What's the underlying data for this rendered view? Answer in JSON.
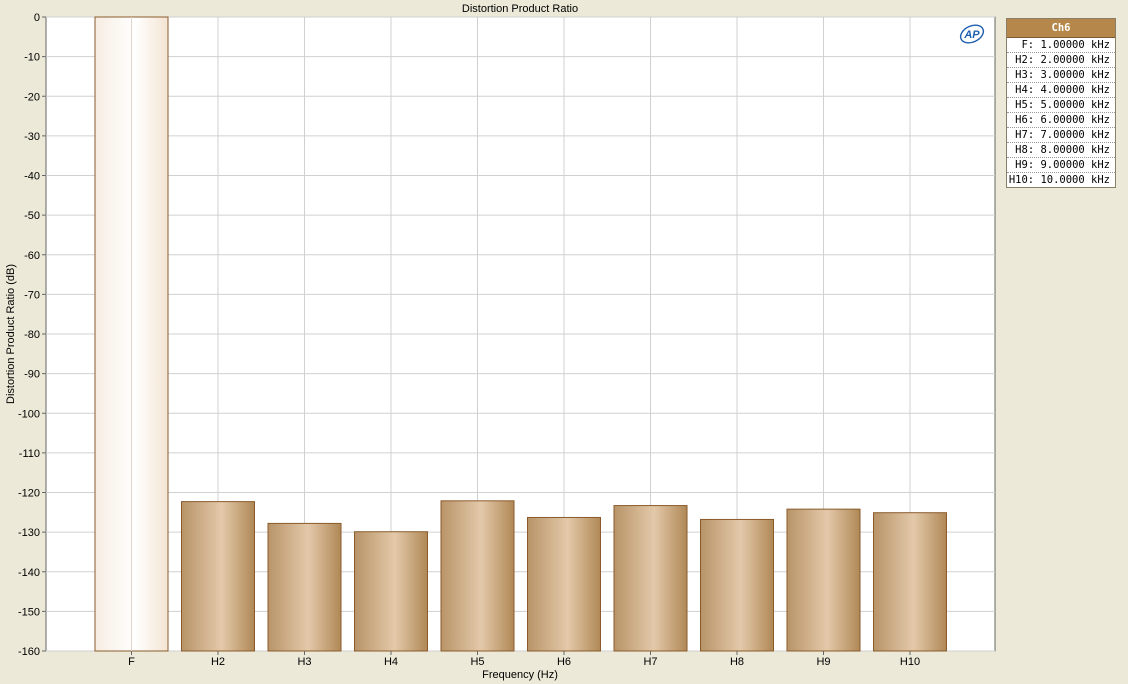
{
  "chart_data": {
    "type": "bar",
    "title": "Distortion Product Ratio",
    "xlabel": "Frequency (Hz)",
    "ylabel": "Distortion Product Ratio (dB)",
    "ylim": [
      -160,
      0
    ],
    "yticks": [
      0,
      -10,
      -20,
      -30,
      -40,
      -50,
      -60,
      -70,
      -80,
      -90,
      -100,
      -110,
      -120,
      -130,
      -140,
      -150,
      -160
    ],
    "grid": true,
    "categories": [
      "F",
      "H2",
      "H3",
      "H4",
      "H5",
      "H6",
      "H7",
      "H8",
      "H9",
      "H10"
    ],
    "series": [
      {
        "name": "Ch6",
        "values": [
          0,
          -122.3,
          -127.8,
          -129.9,
          -122.1,
          -126.3,
          -123.3,
          -126.8,
          -124.2,
          -125.1
        ],
        "color": "#c9a47a"
      }
    ]
  },
  "logo": {
    "text": "AP",
    "color": "#1f5fb0"
  },
  "legend": {
    "header": "Ch6",
    "rows": [
      "F: 1.00000 kHz",
      "H2: 2.00000 kHz",
      "H3: 3.00000 kHz",
      "H4: 4.00000 kHz",
      "H5: 5.00000 kHz",
      "H6: 6.00000 kHz",
      "H7: 7.00000 kHz",
      "H8: 8.00000 kHz",
      "H9: 9.00000 kHz",
      "H10: 10.0000 kHz"
    ]
  }
}
